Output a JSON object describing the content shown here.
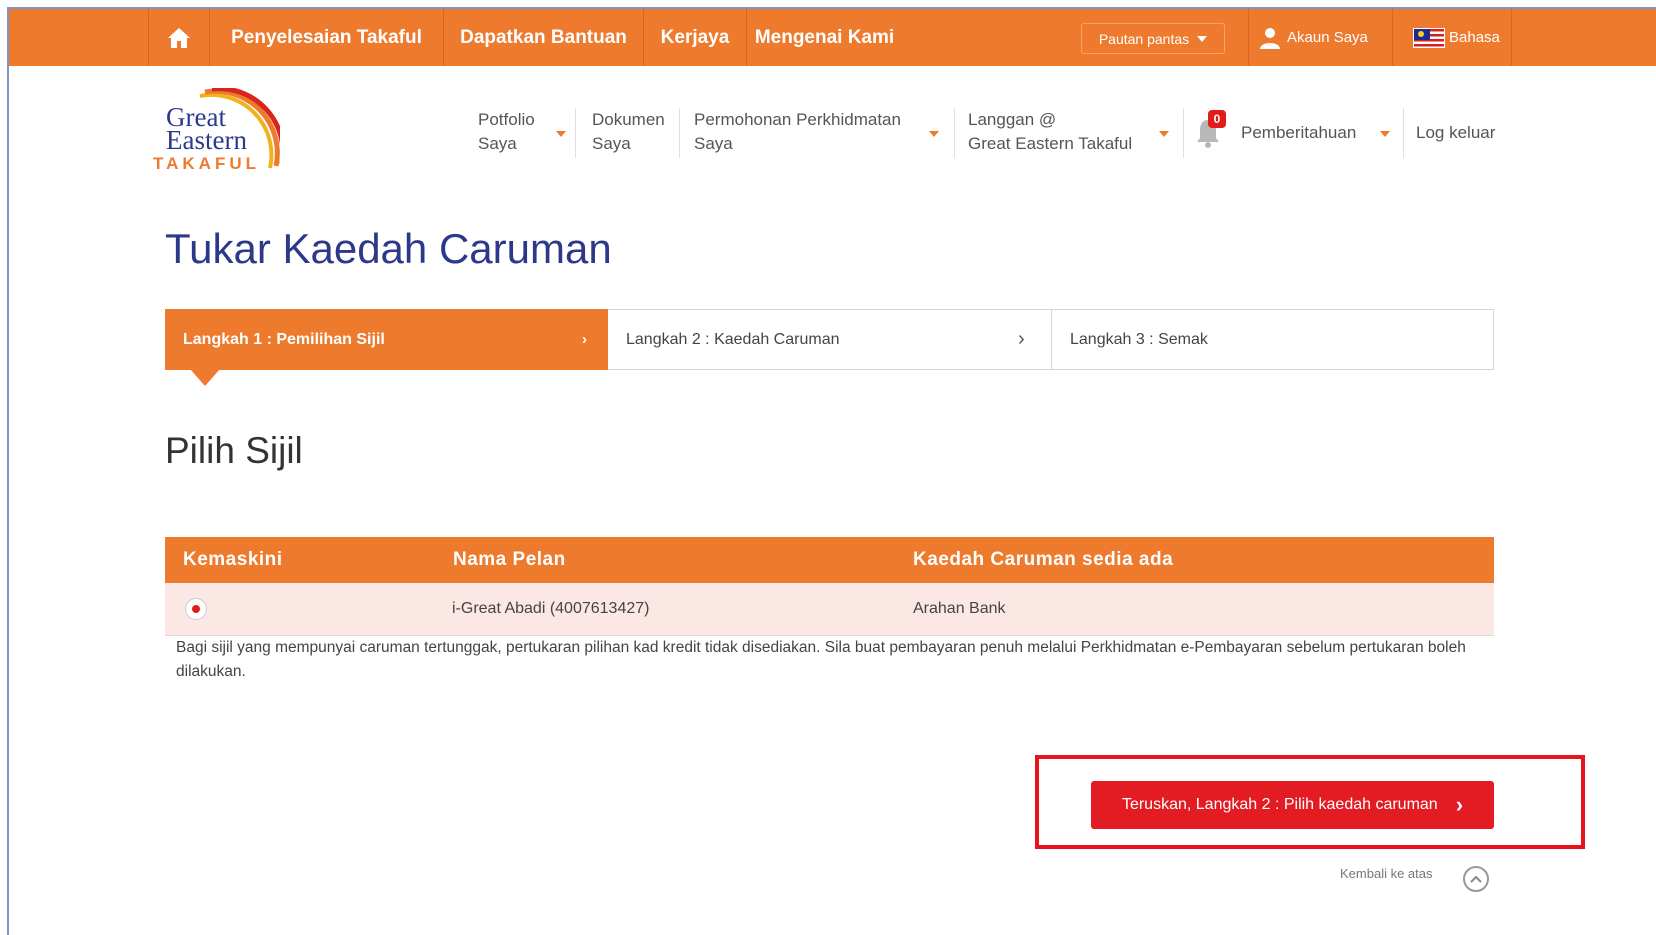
{
  "topbar": {
    "links": [
      "Penyelesaian Takaful",
      "Dapatkan Bantuan",
      "Kerjaya",
      "Mengenai Kami"
    ],
    "quick_links": "Pautan pantas",
    "account": "Akaun Saya",
    "language": "Bahasa",
    "color": "#ee7a2d"
  },
  "logo": {
    "line1": "Great",
    "line2": "Eastern",
    "line3": "TAKAFUL"
  },
  "nav2": {
    "portfolio": [
      "Potfolio",
      "Saya"
    ],
    "documents": [
      "Dokumen",
      "Saya"
    ],
    "service": [
      "Permohonan Perkhidmatan",
      "Saya"
    ],
    "subscribe": [
      "Langgan @",
      "Great Eastern Takaful"
    ],
    "notifications": "Pemberitahuan",
    "notification_count": "0",
    "logout": "Log keluar"
  },
  "page_title": "Tukar Kaedah Caruman",
  "steps": [
    {
      "label": "Langkah 1 : Pemilihan Sijil",
      "active": true
    },
    {
      "label": "Langkah 2 : Kaedah Caruman",
      "active": false
    },
    {
      "label": "Langkah 3 : Semak",
      "active": false
    }
  ],
  "section_title": "Pilih Sijil",
  "table": {
    "headers": [
      "Kemaskini",
      "Nama Pelan",
      "Kaedah Caruman sedia ada"
    ],
    "rows": [
      {
        "selected": true,
        "plan": "i-Great Abadi (4007613427)",
        "method": "Arahan Bank"
      }
    ]
  },
  "note": "Bagi sijil yang mempunyai caruman tertunggak, pertukaran pilihan kad kredit tidak disediakan. Sila buat pembayaran penuh melalui Perkhidmatan e-Pembayaran sebelum pertukaran boleh dilakukan.",
  "continue_button": "Teruskan, Langkah 2 : Pilih kaedah caruman",
  "back_to_top": "Kembali ke atas",
  "colors": {
    "accent": "#ee7a2d",
    "title": "#2c3989",
    "button": "#e31b23",
    "highlight": "#e8141c"
  }
}
